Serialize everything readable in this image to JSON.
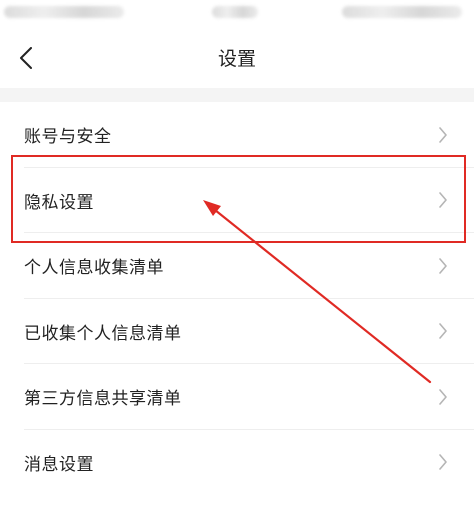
{
  "nav": {
    "title": "设置",
    "back_icon": "chevron-left-icon"
  },
  "settings": {
    "items": [
      {
        "label": "账号与安全"
      },
      {
        "label": "隐私设置"
      },
      {
        "label": "个人信息收集清单"
      },
      {
        "label": "已收集个人信息清单"
      },
      {
        "label": "第三方信息共享清单"
      },
      {
        "label": "消息设置"
      }
    ],
    "chevron_icon": "chevron-right-icon"
  },
  "annotation": {
    "highlight_color": "#e02a24",
    "highlighted_item_index": 1
  }
}
